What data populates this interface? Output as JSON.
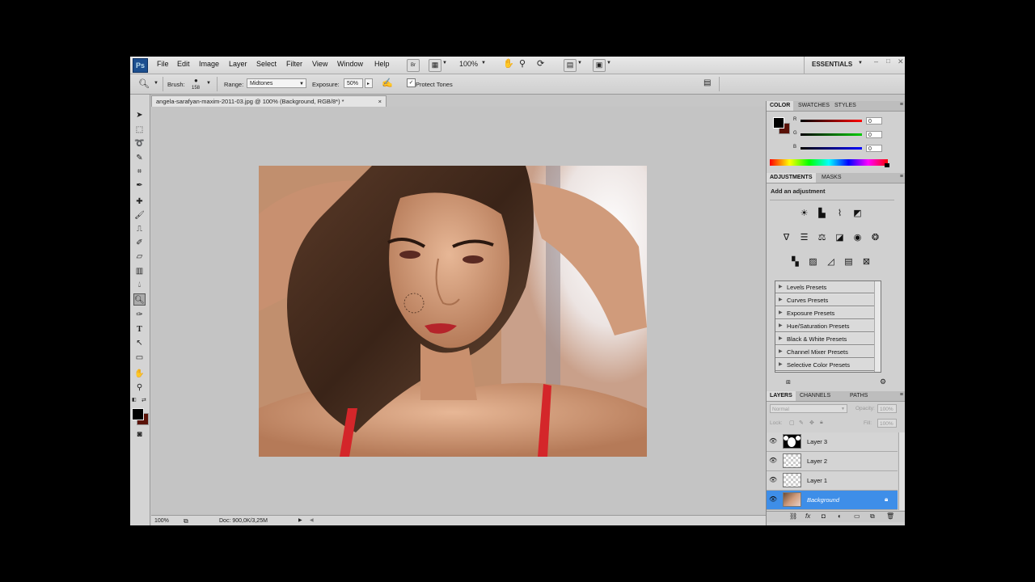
{
  "menubar": {
    "logo": "Ps",
    "items": [
      "File",
      "Edit",
      "Image",
      "Layer",
      "Select",
      "Filter",
      "View",
      "Window",
      "Help"
    ],
    "bridge_label": "Br",
    "zoom": "100%",
    "workspace": "ESSENTIALS"
  },
  "options": {
    "brush_label": "Brush:",
    "brush_size": "158",
    "range_label": "Range:",
    "range_value": "Midtones",
    "exposure_label": "Exposure:",
    "exposure_value": "50%",
    "protect_tones_label": "Protect Tones",
    "protect_tones_checked": true
  },
  "document": {
    "tab_title": "angela-sarafyan-maxim-2011-03.jpg @ 100% (Background, RGB/8*) *",
    "close": "×"
  },
  "status": {
    "zoom": "100%",
    "doc_info": "Doc: 900,0K/3,25M"
  },
  "color_panel": {
    "tabs": [
      "COLOR",
      "SWATCHES",
      "STYLES"
    ],
    "channels": [
      {
        "label": "R",
        "value": "0"
      },
      {
        "label": "G",
        "value": "0"
      },
      {
        "label": "B",
        "value": "0"
      }
    ],
    "foreground": "#000000",
    "background": "#5a1208"
  },
  "adjustments_panel": {
    "tabs": [
      "ADJUSTMENTS",
      "MASKS"
    ],
    "heading": "Add an adjustment",
    "presets": [
      "Levels Presets",
      "Curves Presets",
      "Exposure Presets",
      "Hue/Saturation Presets",
      "Black & White Presets",
      "Channel Mixer Presets",
      "Selective Color Presets"
    ]
  },
  "layers_panel": {
    "tabs": [
      "LAYERS",
      "CHANNELS",
      "PATHS"
    ],
    "blend_mode": "Normal",
    "opacity_label": "Opacity:",
    "opacity_value": "100%",
    "lock_label": "Lock:",
    "fill_label": "Fill:",
    "fill_value": "100%",
    "layers": [
      {
        "name": "Layer 3"
      },
      {
        "name": "Layer 2"
      },
      {
        "name": "Layer 1"
      },
      {
        "name": "Background"
      }
    ]
  },
  "colors": {
    "selected_layer": "#3e8ee8"
  }
}
